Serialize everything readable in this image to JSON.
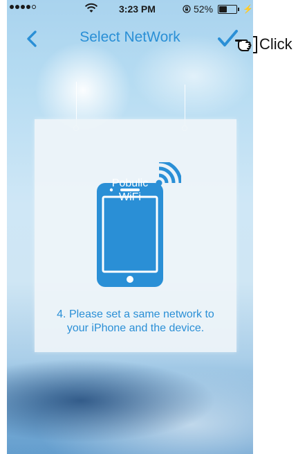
{
  "status_bar": {
    "time": "3:23 PM",
    "battery_percent": "52%",
    "battery_level": 0.52,
    "signal_dots_filled": 4,
    "signal_dots_total": 5
  },
  "nav": {
    "title": "Select NetWork",
    "back_icon": "chevron-left-icon",
    "confirm_icon": "checkmark-icon"
  },
  "card": {
    "device_label_line1": "Pobulic",
    "device_label_line2": "WiFi",
    "instruction_line1": "4. Please set a same network to",
    "instruction_line2": "your iPhone and the device."
  },
  "annotation": {
    "label": "Click",
    "icon": "pointing-hand-icon"
  },
  "colors": {
    "accent": "#2a8fd6"
  }
}
